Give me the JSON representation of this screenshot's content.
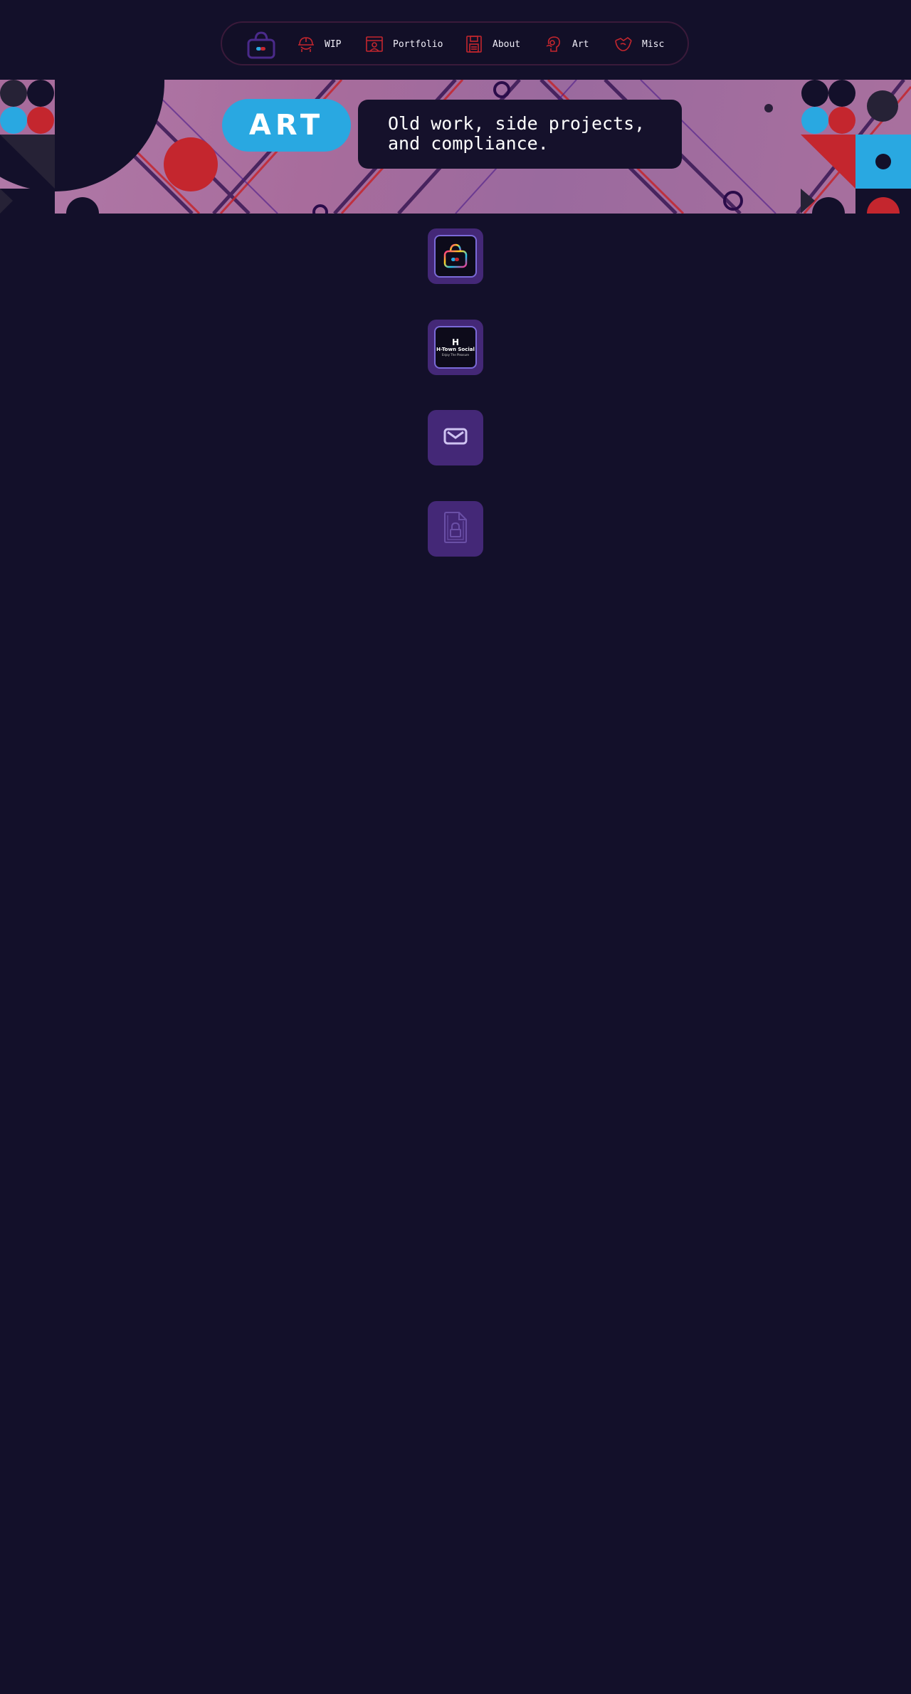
{
  "nav": {
    "logo_icon": "shopping-bag-icon",
    "items": [
      {
        "label": "WIP",
        "icon": "hard-hat-icon"
      },
      {
        "label": "Portfolio",
        "icon": "portfolio-window-icon"
      },
      {
        "label": "About",
        "icon": "floppy-disk-icon"
      },
      {
        "label": "Art",
        "icon": "art-head-icon"
      },
      {
        "label": "Misc",
        "icon": "misc-hand-icon"
      }
    ]
  },
  "hero": {
    "title": "ART",
    "subtitle_line1": "Old work, side projects,",
    "subtitle_line2": "and compliance."
  },
  "tiles": [
    {
      "icon": "rainbow-bag-icon"
    },
    {
      "brand_letter": "H",
      "brand_name": "H-Town Social",
      "brand_tagline": "Enjoy The Pleasure",
      "icon": "h-town-social-logo"
    },
    {
      "icon": "envelope-icon"
    },
    {
      "icon": "locked-document-icon"
    }
  ],
  "colors": {
    "background": "#13102a",
    "accent_blue": "#29a8e1",
    "accent_red": "#c4262e",
    "tile_purple": "#442877",
    "nav_icon_red": "#c4262e"
  }
}
